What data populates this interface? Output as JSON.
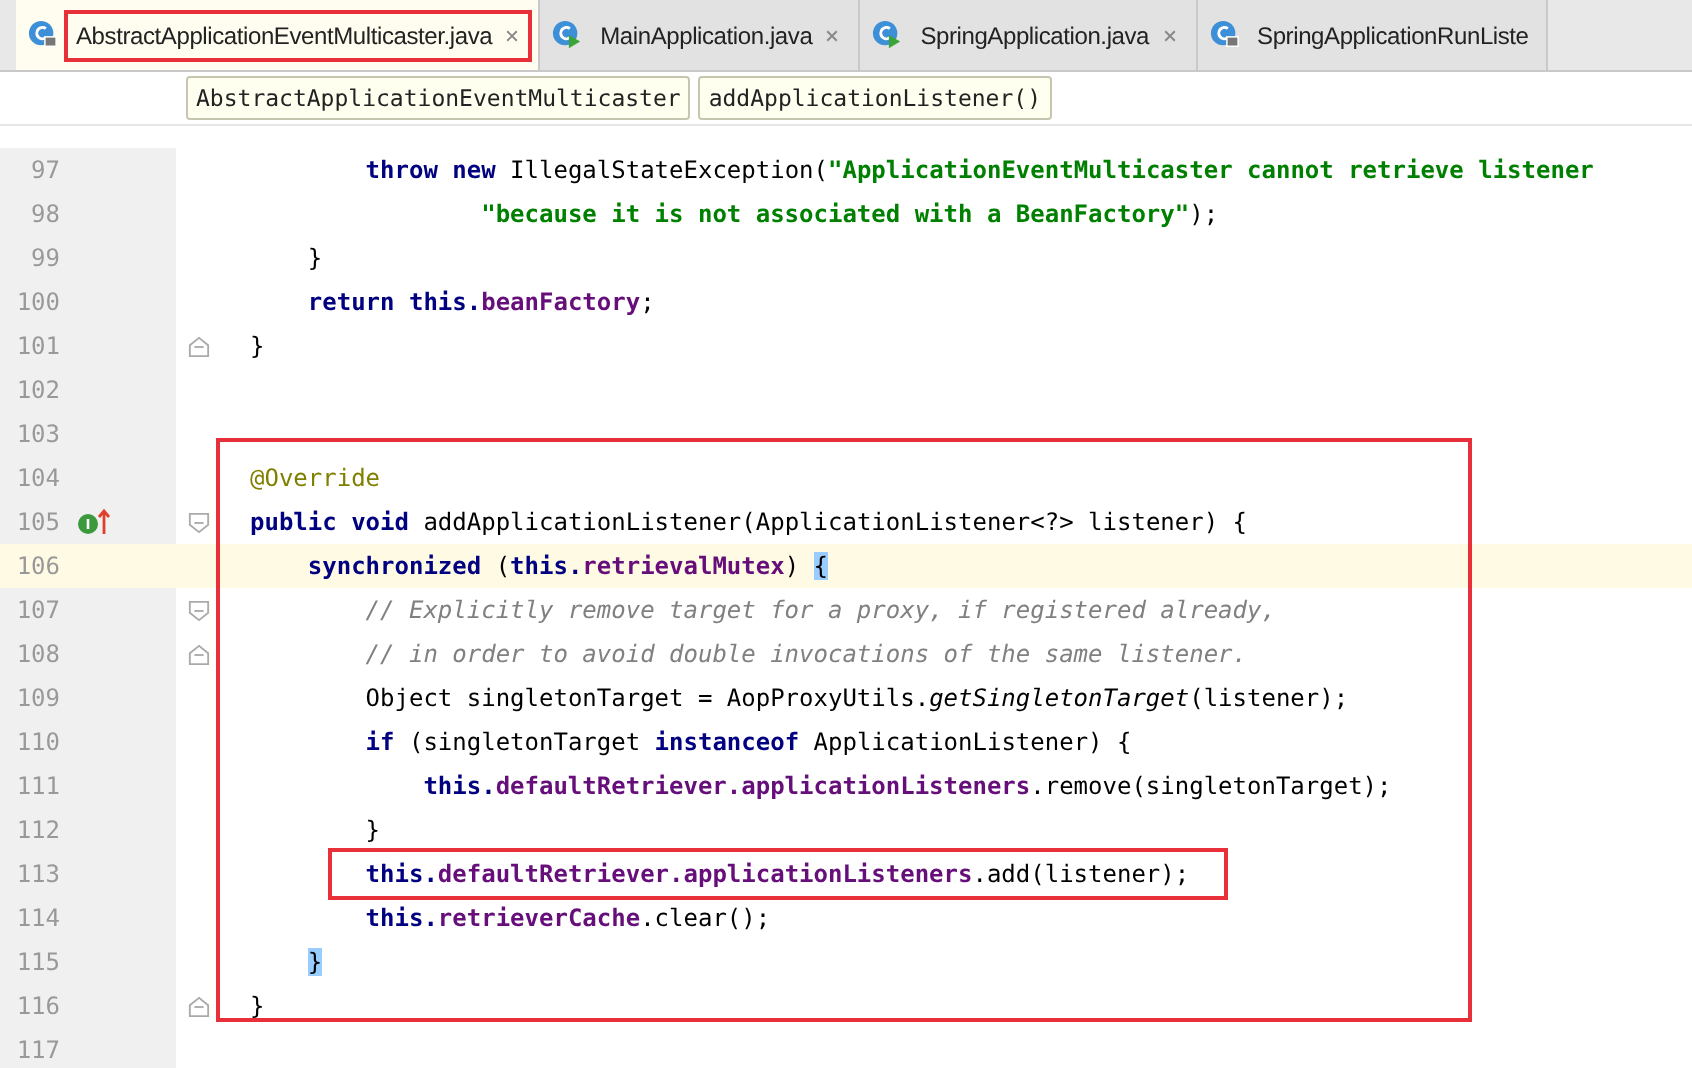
{
  "tabs": [
    {
      "label": "AbstractApplicationEventMulticaster.java",
      "kind": "locked-class",
      "selected": true,
      "outlined": true,
      "closable": true
    },
    {
      "label": "MainApplication.java",
      "kind": "runnable-class",
      "selected": false,
      "outlined": false,
      "closable": true
    },
    {
      "label": "SpringApplication.java",
      "kind": "runnable-class",
      "selected": false,
      "outlined": false,
      "closable": true
    },
    {
      "label": "SpringApplicationRunListe",
      "kind": "locked-class",
      "selected": false,
      "outlined": false,
      "closable": false
    }
  ],
  "breadcrumbs": [
    "AbstractApplicationEventMulticaster",
    "addApplicationListener()"
  ],
  "editor": {
    "blocks": [
      {
        "outlined": false,
        "lines": [
          {
            "kind": "group",
            "children": [
              {
                "kind": "group",
                "children": [
                  {
                    "kind": "code",
                    "number": "97",
                    "tokens": [
                      {
                        "kind": "keyword",
                        "text": "throw new"
                      },
                      {
                        "kind": "plain",
                        "text": " IllegalStateException("
                      },
                      {
                        "kind": "string",
                        "text": "\"ApplicationEventMulticaster cannot retrieve listener"
                      }
                    ],
                    "children": [
                      {
                        "kind": "group",
                        "children": [
                          {
                            "kind": "code",
                            "number": "98",
                            "tokens": [
                              {
                                "kind": "string",
                                "text": "\"because it is not associated with a BeanFactory\""
                              },
                              {
                                "kind": "plain",
                                "text": ");"
                              }
                            ]
                          }
                        ]
                      }
                    ]
                  }
                ]
              },
              {
                "kind": "code",
                "number": "99",
                "tokens": [
                  {
                    "kind": "plain",
                    "text": "}"
                  }
                ]
              },
              {
                "kind": "code",
                "number": "100",
                "tokens": [
                  {
                    "kind": "keyword",
                    "text": "return this."
                  },
                  {
                    "kind": "field",
                    "text": "beanFactory"
                  },
                  {
                    "kind": "plain",
                    "text": ";"
                  }
                ]
              }
            ]
          },
          {
            "kind": "fold-end",
            "number": "101",
            "tokens": [
              {
                "kind": "plain",
                "text": "}"
              }
            ]
          },
          {
            "kind": "code",
            "number": "102"
          },
          {
            "kind": "code",
            "number": "103"
          }
        ]
      },
      {
        "outlined": true,
        "lines": [
          {
            "kind": "code",
            "number": "104",
            "tokens": [
              {
                "kind": "annotation",
                "text": "@Override"
              }
            ]
          },
          {
            "kind": "fold-start",
            "number": "105",
            "override": true,
            "tokens": [
              {
                "kind": "keyword",
                "text": "public void"
              },
              {
                "kind": "plain",
                "text": " addApplicationListener(ApplicationListener<?> listener) {"
              }
            ],
            "children": [
              {
                "kind": "code",
                "number": "106",
                "current": true,
                "tokens": [
                  {
                    "kind": "keyword",
                    "text": "synchronized"
                  },
                  {
                    "kind": "plain",
                    "text": " ("
                  },
                  {
                    "kind": "keyword",
                    "text": "this."
                  },
                  {
                    "kind": "field",
                    "text": "retrievalMutex"
                  },
                  {
                    "kind": "plain",
                    "text": ") "
                  },
                  {
                    "kind": "brace",
                    "text": "{"
                  }
                ],
                "children": [
                  {
                    "kind": "fold-start",
                    "number": "107",
                    "tokens": [
                      {
                        "kind": "comment",
                        "text": "// Explicitly remove target for a proxy, if registered already,"
                      }
                    ]
                  },
                  {
                    "kind": "fold-end",
                    "number": "108",
                    "tokens": [
                      {
                        "kind": "comment",
                        "text": "// in order to avoid double invocations of the same listener."
                      }
                    ]
                  },
                  {
                    "kind": "code",
                    "number": "109",
                    "tokens": [
                      {
                        "kind": "plain",
                        "text": "Object singletonTarget = AopProxyUtils."
                      },
                      {
                        "kind": "static",
                        "text": "getSingletonTarget"
                      },
                      {
                        "kind": "plain",
                        "text": "(listener);"
                      }
                    ]
                  },
                  {
                    "kind": "code",
                    "number": "110",
                    "tokens": [
                      {
                        "kind": "keyword",
                        "text": "if"
                      },
                      {
                        "kind": "plain",
                        "text": " (singletonTarget "
                      },
                      {
                        "kind": "keyword",
                        "text": "instanceof"
                      },
                      {
                        "kind": "plain",
                        "text": " ApplicationListener) {"
                      }
                    ],
                    "children": [
                      {
                        "kind": "code",
                        "number": "111",
                        "tokens": [
                          {
                            "kind": "keyword",
                            "text": "this."
                          },
                          {
                            "kind": "field",
                            "text": "defaultRetriever.applicationListeners"
                          },
                          {
                            "kind": "plain",
                            "text": ".remove(singletonTarget);"
                          }
                        ]
                      }
                    ]
                  },
                  {
                    "kind": "code",
                    "number": "112",
                    "tokens": [
                      {
                        "kind": "plain",
                        "text": "}"
                      }
                    ]
                  },
                  {
                    "kind": "code",
                    "number": "113",
                    "outlined": true,
                    "tokens": [
                      {
                        "kind": "keyword",
                        "text": "this."
                      },
                      {
                        "kind": "field",
                        "text": "defaultRetriever.applicationListeners"
                      },
                      {
                        "kind": "plain",
                        "text": ".add(listener);"
                      }
                    ]
                  },
                  {
                    "kind": "code",
                    "number": "114",
                    "tokens": [
                      {
                        "kind": "keyword",
                        "text": "this."
                      },
                      {
                        "kind": "field",
                        "text": "retrieverCache"
                      },
                      {
                        "kind": "plain",
                        "text": ".clear();"
                      }
                    ]
                  }
                ]
              },
              {
                "kind": "code",
                "number": "115",
                "tokens": [
                  {
                    "kind": "brace",
                    "text": "}"
                  }
                ]
              }
            ]
          },
          {
            "kind": "fold-end",
            "number": "116",
            "tokens": [
              {
                "kind": "plain",
                "text": "}"
              }
            ]
          }
        ]
      },
      {
        "outlined": false,
        "lines": [
          {
            "kind": "code",
            "number": "117"
          }
        ]
      }
    ]
  }
}
